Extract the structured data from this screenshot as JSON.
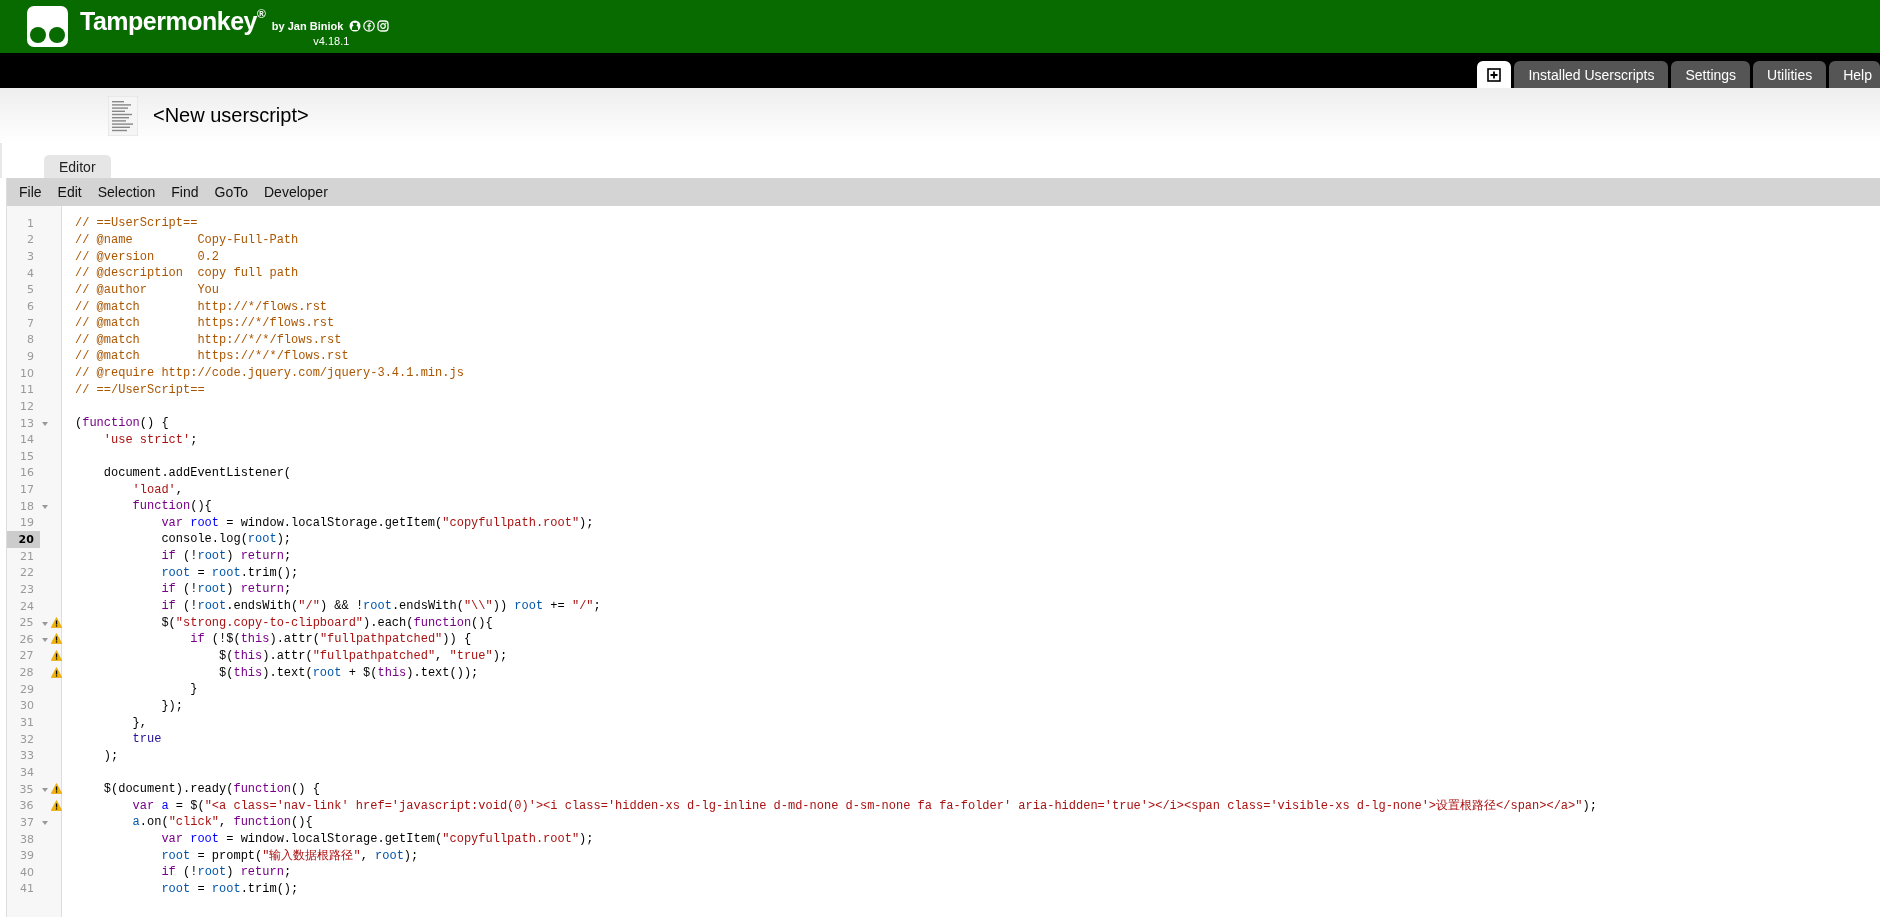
{
  "app": {
    "name": "Tampermonkey",
    "registered": "®",
    "byline": "by Jan Biniok",
    "version": "v4.18.1"
  },
  "nav_tabs": [
    {
      "kind": "icon",
      "selected": true
    },
    {
      "kind": "text",
      "label": "Installed Userscripts",
      "selected": false
    },
    {
      "kind": "text",
      "label": "Settings",
      "selected": false
    },
    {
      "kind": "text",
      "label": "Utilities",
      "selected": false
    },
    {
      "kind": "text",
      "label": "Help",
      "selected": false
    }
  ],
  "script": {
    "title": "<New userscript>"
  },
  "editor_tabs": [
    {
      "label": "Editor",
      "selected": true
    }
  ],
  "menu": [
    "File",
    "Edit",
    "Selection",
    "Find",
    "GoTo",
    "Developer"
  ],
  "code_lines": [
    {
      "number": "1",
      "fold": false,
      "warning": false,
      "current": false,
      "tokens": [
        {
          "kind": "comment",
          "text": "// ==UserScript=="
        }
      ]
    },
    {
      "number": "2",
      "fold": false,
      "warning": false,
      "current": false,
      "tokens": [
        {
          "kind": "comment",
          "text": "// @name         Copy-Full-Path"
        }
      ]
    },
    {
      "number": "3",
      "fold": false,
      "warning": false,
      "current": false,
      "tokens": [
        {
          "kind": "comment",
          "text": "// @version      0.2"
        }
      ]
    },
    {
      "number": "4",
      "fold": false,
      "warning": false,
      "current": false,
      "tokens": [
        {
          "kind": "comment",
          "text": "// @description  copy full path"
        }
      ]
    },
    {
      "number": "5",
      "fold": false,
      "warning": false,
      "current": false,
      "tokens": [
        {
          "kind": "comment",
          "text": "// @author       You"
        }
      ]
    },
    {
      "number": "6",
      "fold": false,
      "warning": false,
      "current": false,
      "tokens": [
        {
          "kind": "comment",
          "text": "// @match        http://*/flows.rst"
        }
      ]
    },
    {
      "number": "7",
      "fold": false,
      "warning": false,
      "current": false,
      "tokens": [
        {
          "kind": "comment",
          "text": "// @match        https://*/flows.rst"
        }
      ]
    },
    {
      "number": "8",
      "fold": false,
      "warning": false,
      "current": false,
      "tokens": [
        {
          "kind": "comment",
          "text": "// @match        http://*/*/flows.rst"
        }
      ]
    },
    {
      "number": "9",
      "fold": false,
      "warning": false,
      "current": false,
      "tokens": [
        {
          "kind": "comment",
          "text": "// @match        https://*/*/flows.rst"
        }
      ]
    },
    {
      "number": "10",
      "fold": false,
      "warning": false,
      "current": false,
      "tokens": [
        {
          "kind": "comment",
          "text": "// @require http://code.jquery.com/jquery-3.4.1.min.js"
        }
      ]
    },
    {
      "number": "11",
      "fold": false,
      "warning": false,
      "current": false,
      "tokens": [
        {
          "kind": "comment",
          "text": "// ==/UserScript=="
        }
      ]
    },
    {
      "number": "12",
      "fold": false,
      "warning": false,
      "current": false
    },
    {
      "number": "13",
      "fold": true,
      "warning": false,
      "current": false,
      "tokens": [
        {
          "kind": "plain",
          "text": "("
        },
        {
          "kind": "keyword",
          "text": "function"
        },
        {
          "kind": "plain",
          "text": "() {"
        }
      ]
    },
    {
      "number": "14",
      "fold": false,
      "warning": false,
      "current": false,
      "tokens": [
        {
          "kind": "string",
          "text": "    'use strict'"
        },
        {
          "kind": "plain",
          "text": ";"
        }
      ]
    },
    {
      "number": "15",
      "fold": false,
      "warning": false,
      "current": false
    },
    {
      "number": "16",
      "fold": false,
      "warning": false,
      "current": false,
      "tokens": [
        {
          "kind": "plain",
          "text": "    document.addEventListener("
        }
      ]
    },
    {
      "number": "17",
      "fold": false,
      "warning": false,
      "current": false,
      "tokens": [
        {
          "kind": "string",
          "text": "        'load'"
        },
        {
          "kind": "plain",
          "text": ","
        }
      ]
    },
    {
      "number": "18",
      "fold": true,
      "warning": false,
      "current": false,
      "tokens": [
        {
          "kind": "keyword",
          "text": "        function"
        },
        {
          "kind": "plain",
          "text": "(){"
        }
      ]
    },
    {
      "number": "19",
      "fold": false,
      "warning": false,
      "current": false,
      "tokens": [
        {
          "kind": "keyword",
          "text": "            var "
        },
        {
          "kind": "def",
          "text": "root"
        },
        {
          "kind": "plain",
          "text": " = window.localStorage.getItem("
        },
        {
          "kind": "string",
          "text": "\"copyfullpath.root\""
        },
        {
          "kind": "plain",
          "text": ");"
        }
      ]
    },
    {
      "number": "20",
      "fold": false,
      "warning": false,
      "current": true,
      "tokens": [
        {
          "kind": "plain",
          "text": "            console.log("
        },
        {
          "kind": "variable",
          "text": "root"
        },
        {
          "kind": "plain",
          "text": ");"
        }
      ]
    },
    {
      "number": "21",
      "fold": false,
      "warning": false,
      "current": false,
      "tokens": [
        {
          "kind": "keyword",
          "text": "            if"
        },
        {
          "kind": "plain",
          "text": " (!"
        },
        {
          "kind": "variable",
          "text": "root"
        },
        {
          "kind": "plain",
          "text": ") "
        },
        {
          "kind": "keyword",
          "text": "return"
        },
        {
          "kind": "plain",
          "text": ";"
        }
      ]
    },
    {
      "number": "22",
      "fold": false,
      "warning": false,
      "current": false,
      "tokens": [
        {
          "kind": "variable",
          "text": "            root"
        },
        {
          "kind": "plain",
          "text": " = "
        },
        {
          "kind": "variable",
          "text": "root"
        },
        {
          "kind": "plain",
          "text": ".trim();"
        }
      ]
    },
    {
      "number": "23",
      "fold": false,
      "warning": false,
      "current": false,
      "tokens": [
        {
          "kind": "keyword",
          "text": "            if"
        },
        {
          "kind": "plain",
          "text": " (!"
        },
        {
          "kind": "variable",
          "text": "root"
        },
        {
          "kind": "plain",
          "text": ") "
        },
        {
          "kind": "keyword",
          "text": "return"
        },
        {
          "kind": "plain",
          "text": ";"
        }
      ]
    },
    {
      "number": "24",
      "fold": false,
      "warning": false,
      "current": false,
      "tokens": [
        {
          "kind": "keyword",
          "text": "            if"
        },
        {
          "kind": "plain",
          "text": " (!"
        },
        {
          "kind": "variable",
          "text": "root"
        },
        {
          "kind": "plain",
          "text": ".endsWith("
        },
        {
          "kind": "string",
          "text": "\"/\""
        },
        {
          "kind": "plain",
          "text": ") && !"
        },
        {
          "kind": "variable",
          "text": "root"
        },
        {
          "kind": "plain",
          "text": ".endsWith("
        },
        {
          "kind": "string",
          "text": "\"\\\\\""
        },
        {
          "kind": "plain",
          "text": ")) "
        },
        {
          "kind": "variable",
          "text": "root"
        },
        {
          "kind": "plain",
          "text": " += "
        },
        {
          "kind": "string",
          "text": "\"/\""
        },
        {
          "kind": "plain",
          "text": ";"
        }
      ]
    },
    {
      "number": "25",
      "fold": true,
      "warning": true,
      "current": false,
      "tokens": [
        {
          "kind": "plain",
          "text": "            $("
        },
        {
          "kind": "string",
          "text": "\"strong.copy-to-clipboard\""
        },
        {
          "kind": "plain",
          "text": ").each("
        },
        {
          "kind": "keyword",
          "text": "function"
        },
        {
          "kind": "plain",
          "text": "(){"
        }
      ]
    },
    {
      "number": "26",
      "fold": true,
      "warning": true,
      "current": false,
      "tokens": [
        {
          "kind": "keyword",
          "text": "                if"
        },
        {
          "kind": "plain",
          "text": " (!$("
        },
        {
          "kind": "keyword",
          "text": "this"
        },
        {
          "kind": "plain",
          "text": ").attr("
        },
        {
          "kind": "string",
          "text": "\"fullpathpatched\""
        },
        {
          "kind": "plain",
          "text": ")) {"
        }
      ]
    },
    {
      "number": "27",
      "fold": false,
      "warning": true,
      "current": false,
      "tokens": [
        {
          "kind": "plain",
          "text": "                    $("
        },
        {
          "kind": "keyword",
          "text": "this"
        },
        {
          "kind": "plain",
          "text": ").attr("
        },
        {
          "kind": "string",
          "text": "\"fullpathpatched\""
        },
        {
          "kind": "plain",
          "text": ", "
        },
        {
          "kind": "string",
          "text": "\"true\""
        },
        {
          "kind": "plain",
          "text": ");"
        }
      ]
    },
    {
      "number": "28",
      "fold": false,
      "warning": true,
      "current": false,
      "tokens": [
        {
          "kind": "plain",
          "text": "                    $("
        },
        {
          "kind": "keyword",
          "text": "this"
        },
        {
          "kind": "plain",
          "text": ").text("
        },
        {
          "kind": "variable",
          "text": "root"
        },
        {
          "kind": "plain",
          "text": " + $("
        },
        {
          "kind": "keyword",
          "text": "this"
        },
        {
          "kind": "plain",
          "text": ").text());"
        }
      ]
    },
    {
      "number": "29",
      "fold": false,
      "warning": false,
      "current": false,
      "tokens": [
        {
          "kind": "plain",
          "text": "                }"
        }
      ]
    },
    {
      "number": "30",
      "fold": false,
      "warning": false,
      "current": false,
      "tokens": [
        {
          "kind": "plain",
          "text": "            });"
        }
      ]
    },
    {
      "number": "31",
      "fold": false,
      "warning": false,
      "current": false,
      "tokens": [
        {
          "kind": "plain",
          "text": "        },"
        }
      ]
    },
    {
      "number": "32",
      "fold": false,
      "warning": false,
      "current": false,
      "tokens": [
        {
          "kind": "atom",
          "text": "        true"
        }
      ]
    },
    {
      "number": "33",
      "fold": false,
      "warning": false,
      "current": false,
      "tokens": [
        {
          "kind": "plain",
          "text": "    );"
        }
      ]
    },
    {
      "number": "34",
      "fold": false,
      "warning": false,
      "current": false
    },
    {
      "number": "35",
      "fold": true,
      "warning": true,
      "current": false,
      "tokens": [
        {
          "kind": "plain",
          "text": "    $(document).ready("
        },
        {
          "kind": "keyword",
          "text": "function"
        },
        {
          "kind": "plain",
          "text": "() {"
        }
      ]
    },
    {
      "number": "36",
      "fold": false,
      "warning": true,
      "current": false,
      "tokens": [
        {
          "kind": "keyword",
          "text": "        var "
        },
        {
          "kind": "def",
          "text": "a"
        },
        {
          "kind": "plain",
          "text": " = $("
        },
        {
          "kind": "string",
          "text": "\"<a class='nav-link' href='javascript:void(0)'><i class='hidden-xs d-lg-inline d-md-none d-sm-none fa fa-folder' aria-hidden='true'></i><span class='visible-xs d-lg-none'>设置根路径</span></a>\""
        },
        {
          "kind": "plain",
          "text": ");"
        }
      ]
    },
    {
      "number": "37",
      "fold": true,
      "warning": false,
      "current": false,
      "tokens": [
        {
          "kind": "variable",
          "text": "        a"
        },
        {
          "kind": "plain",
          "text": ".on("
        },
        {
          "kind": "string",
          "text": "\"click\""
        },
        {
          "kind": "plain",
          "text": ", "
        },
        {
          "kind": "keyword",
          "text": "function"
        },
        {
          "kind": "plain",
          "text": "(){"
        }
      ]
    },
    {
      "number": "38",
      "fold": false,
      "warning": false,
      "current": false,
      "tokens": [
        {
          "kind": "keyword",
          "text": "            var "
        },
        {
          "kind": "def",
          "text": "root"
        },
        {
          "kind": "plain",
          "text": " = window.localStorage.getItem("
        },
        {
          "kind": "string",
          "text": "\"copyfullpath.root\""
        },
        {
          "kind": "plain",
          "text": ");"
        }
      ]
    },
    {
      "number": "39",
      "fold": false,
      "warning": false,
      "current": false,
      "tokens": [
        {
          "kind": "variable",
          "text": "            root"
        },
        {
          "kind": "plain",
          "text": " = prompt("
        },
        {
          "kind": "string",
          "text": "\"输入数据根路径\""
        },
        {
          "kind": "plain",
          "text": ", "
        },
        {
          "kind": "variable",
          "text": "root"
        },
        {
          "kind": "plain",
          "text": ");"
        }
      ]
    },
    {
      "number": "40",
      "fold": false,
      "warning": false,
      "current": false,
      "tokens": [
        {
          "kind": "keyword",
          "text": "            if"
        },
        {
          "kind": "plain",
          "text": " (!"
        },
        {
          "kind": "variable",
          "text": "root"
        },
        {
          "kind": "plain",
          "text": ") "
        },
        {
          "kind": "keyword",
          "text": "return"
        },
        {
          "kind": "plain",
          "text": ";"
        }
      ]
    },
    {
      "number": "41",
      "fold": false,
      "warning": false,
      "current": false,
      "tokens": [
        {
          "kind": "variable",
          "text": "            root"
        },
        {
          "kind": "plain",
          "text": " = "
        },
        {
          "kind": "variable",
          "text": "root"
        },
        {
          "kind": "plain",
          "text": ".trim();"
        }
      ]
    }
  ]
}
